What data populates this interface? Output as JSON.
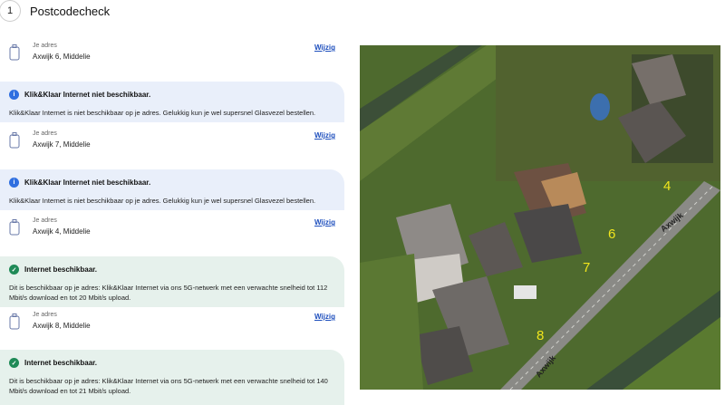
{
  "step": {
    "number": "1",
    "title": "Postcodecheck"
  },
  "address_label": "Je adres",
  "change_label": "Wijzig",
  "entries": [
    {
      "address": "Axwijk 6, Middelie"
    },
    {
      "status_title": "Klik&Klaar Internet niet beschikbaar.",
      "status_text": "Klik&Klaar Internet is niet beschikbaar op je adres. Gelukkig kun je wel supersnel Glasvezel bestellen.",
      "address": "Axwijk 7, Middelie"
    },
    {
      "status_title": "Klik&Klaar Internet niet beschikbaar.",
      "status_text": "Klik&Klaar Internet is niet beschikbaar op je adres. Gelukkig kun je wel supersnel Glasvezel bestellen.",
      "address": "Axwijk 4, Middelie"
    },
    {
      "status_title": "Internet beschikbaar.",
      "status_text": "Dit is beschikbaar op je adres: Klik&Klaar Internet via ons 5G-netwerk met een verwachte snelheid tot 112 Mbit/s download en tot 20 Mbit/s upload.",
      "address": "Axwijk 8, Middelie"
    },
    {
      "status_title": "Internet beschikbaar.",
      "status_text": "Dit is beschikbaar op je adres: Klik&Klaar Internet via ons 5G-netwerk met een verwachte snelheid tot 140 Mbit/s download en tot 21 Mbit/s upload."
    }
  ],
  "map": {
    "house_labels": [
      "4",
      "6",
      "7",
      "8"
    ],
    "road_labels": [
      "Axwijk",
      "Axwijk"
    ]
  },
  "colors": {
    "link": "#1e4fbd",
    "info_blue": "#2f6fe0",
    "success_green": "#1f8a57",
    "label_yellow": "#f1e61c"
  }
}
